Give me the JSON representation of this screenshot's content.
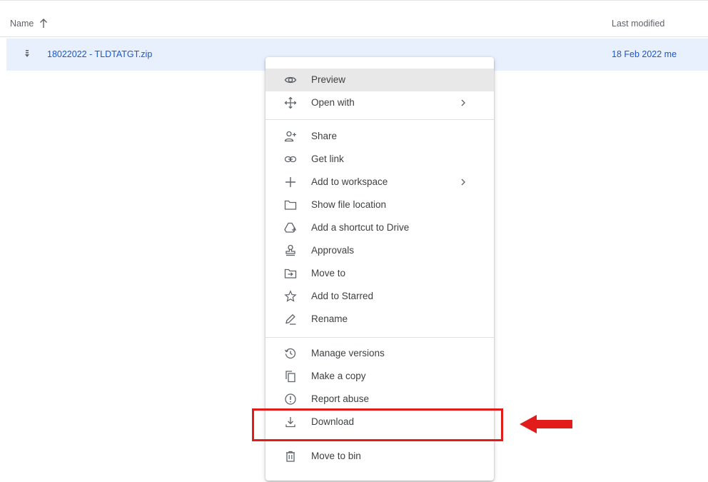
{
  "list": {
    "header_name": "Name",
    "header_modified": "Last modified",
    "sort_icon": "arrow-up-icon"
  },
  "file": {
    "name": "18022022 - TLDTATGT.zip",
    "modified": "18 Feb 2022 me",
    "icon": "zip-file-icon"
  },
  "menu": {
    "items": [
      {
        "label": "Preview",
        "icon": "eye-icon"
      },
      {
        "label": "Open with",
        "icon": "move-arrows-icon"
      },
      {
        "label": "Share",
        "icon": "person-add-icon"
      },
      {
        "label": "Get link",
        "icon": "link-icon"
      },
      {
        "label": "Add to workspace",
        "icon": "plus-icon"
      },
      {
        "label": "Show file location",
        "icon": "folder-icon"
      },
      {
        "label": "Add a shortcut to Drive",
        "icon": "drive-shortcut-icon"
      },
      {
        "label": "Approvals",
        "icon": "approval-stamp-icon"
      },
      {
        "label": "Move to",
        "icon": "move-to-folder-icon"
      },
      {
        "label": "Add to Starred",
        "icon": "star-icon"
      },
      {
        "label": "Rename",
        "icon": "pencil-icon"
      },
      {
        "label": "Manage versions",
        "icon": "history-icon"
      },
      {
        "label": "Make a copy",
        "icon": "copy-icon"
      },
      {
        "label": "Report abuse",
        "icon": "alert-circle-icon"
      },
      {
        "label": "Download",
        "icon": "download-icon"
      },
      {
        "label": "Move to bin",
        "icon": "trash-icon"
      }
    ],
    "submenu_icon": "chevron-right-icon"
  },
  "annotation": {
    "highlight_color": "#e21b1b",
    "arrow_icon": "red-arrow-left-icon"
  },
  "colors": {
    "selected_row": "#e8f0fe",
    "link_blue": "#1a57c9",
    "hover_gray": "#e8e8e8"
  }
}
